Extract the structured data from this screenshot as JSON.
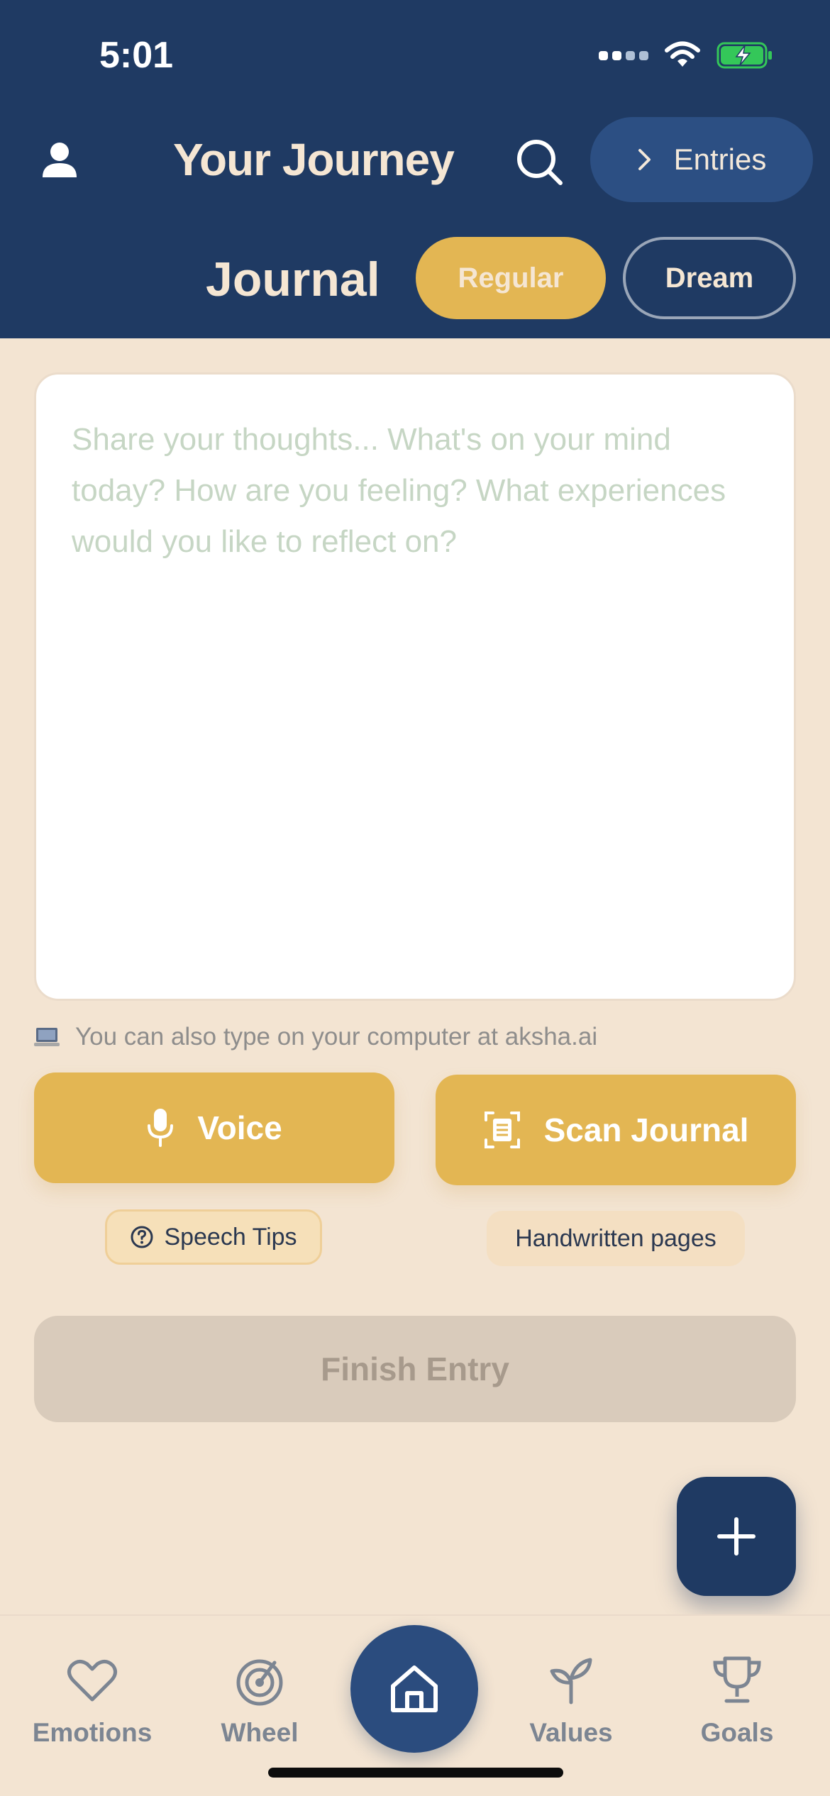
{
  "status_bar": {
    "time": "5:01"
  },
  "header": {
    "title": "Your Journey",
    "entries_label": "Entries",
    "mode_label": "Journal",
    "modes": [
      {
        "label": "Regular",
        "active": true
      },
      {
        "label": "Dream",
        "active": false
      }
    ]
  },
  "editor": {
    "placeholder": "Share your thoughts... What's on your mind today? How are you feeling? What experiences would you like to reflect on?",
    "value": ""
  },
  "hint": {
    "text": "You can also type on your computer at aksha.ai"
  },
  "actions": {
    "voice_label": "Voice",
    "scan_label": "Scan Journal",
    "speech_tips_label": "Speech Tips",
    "handwritten_label": "Handwritten pages",
    "finish_label": "Finish Entry"
  },
  "tabs": {
    "emotions": "Emotions",
    "wheel": "Wheel",
    "values": "Values",
    "goals": "Goals"
  },
  "colors": {
    "header_bg": "#1F3A63",
    "accent_gold": "#E3B653",
    "page_bg": "#F3E4D2",
    "disabled": "#D9CBBB"
  },
  "icons": {
    "profile": "person-icon",
    "search": "search-icon",
    "entries": "chevron-right-icon",
    "voice": "microphone-icon",
    "scan": "scan-document-icon",
    "help": "question-circle-icon",
    "fab": "plus-icon",
    "emotions": "heart-icon",
    "wheel": "target-icon",
    "home": "home-icon",
    "values": "sprout-icon",
    "goals": "trophy-icon",
    "hint": "laptop-icon"
  }
}
